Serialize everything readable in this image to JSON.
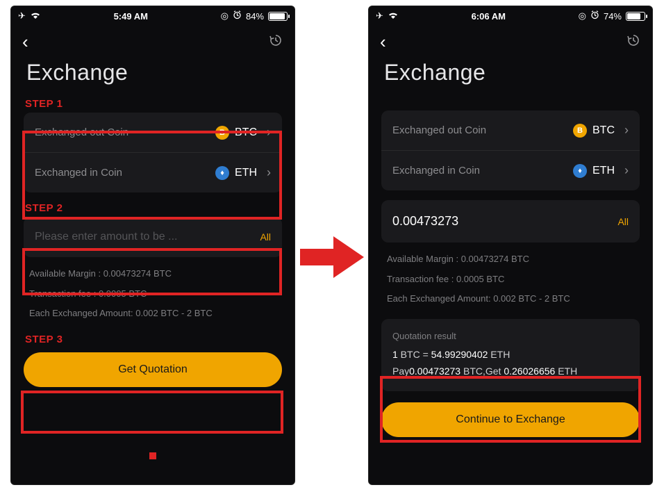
{
  "left": {
    "status": {
      "time": "5:49 AM",
      "battery_pct": "84%",
      "battery_fill": "84%"
    },
    "title": "Exchange",
    "steps": {
      "s1": "STEP 1",
      "s2": "STEP 2",
      "s3": "STEP 3"
    },
    "coins": {
      "out_label": "Exchanged out Coin",
      "out_code": "BTC",
      "out_glyph": "B",
      "in_label": "Exchanged in Coin",
      "in_code": "ETH",
      "in_glyph": "♦"
    },
    "amount": {
      "placeholder": "Please enter amount to be ...",
      "all": "All"
    },
    "info": {
      "margin": "Available Margin :  0.00473274 BTC",
      "fee": "Transaction fee :  0.0005 BTC",
      "range": "Each Exchanged Amount: 0.002 BTC  -  2 BTC"
    },
    "button": "Get Quotation"
  },
  "right": {
    "status": {
      "time": "6:06 AM",
      "battery_pct": "74%",
      "battery_fill": "74%"
    },
    "title": "Exchange",
    "coins": {
      "out_label": "Exchanged out Coin",
      "out_code": "BTC",
      "out_glyph": "B",
      "in_label": "Exchanged in Coin",
      "in_code": "ETH",
      "in_glyph": "♦"
    },
    "amount": {
      "value": "0.00473273",
      "all": "All"
    },
    "info": {
      "margin": "Available Margin :  0.00473274 BTC",
      "fee": "Transaction fee :  0.0005 BTC",
      "range": "Each Exchanged Amount: 0.002 BTC  -  2 BTC"
    },
    "quotation": {
      "title": "Quotation result",
      "rate_lhs": "1",
      "rate_lhs_unit": " BTC = ",
      "rate_rhs": "54.99290402",
      "rate_rhs_unit": " ETH",
      "pay_prefix": "Pay",
      "pay_amt": "0.00473273",
      "pay_unit": " BTC,",
      "get_prefix": "Get ",
      "get_amt": "0.26026656",
      "get_unit": " ETH"
    },
    "button": "Continue to Exchange"
  },
  "icons": {
    "airplane": "✈",
    "wifi": "wifi",
    "target": "◎",
    "alarm": "⏰",
    "history": "↺"
  }
}
